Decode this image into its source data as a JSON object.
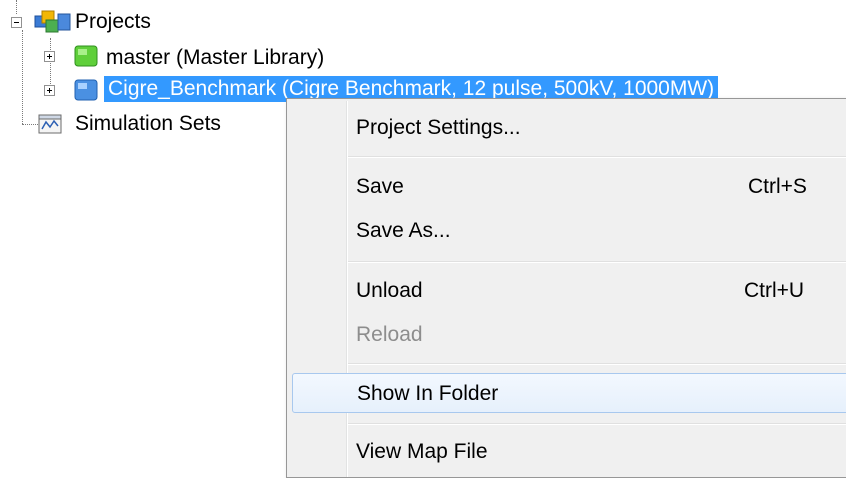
{
  "tree": {
    "root": {
      "label": "Projects",
      "icon": "projects-icon"
    },
    "children": [
      {
        "label": "master (Master Library)",
        "icon": "library-icon"
      },
      {
        "label": "Cigre_Benchmark (Cigre Benchmark, 12 pulse, 500kV, 1000MW)",
        "icon": "project-icon",
        "selected": true
      }
    ],
    "simulation_sets": {
      "label": "Simulation Sets",
      "icon": "simulation-sets-icon"
    }
  },
  "context_menu": {
    "project_settings": {
      "label": "Project Settings..."
    },
    "save": {
      "label": "Save",
      "shortcut": "Ctrl+S"
    },
    "save_as": {
      "label": "Save As..."
    },
    "unload": {
      "label": "Unload",
      "shortcut": "Ctrl+U"
    },
    "reload": {
      "label": "Reload",
      "disabled": true
    },
    "show_in_folder": {
      "label": "Show In Folder",
      "highlighted": true
    },
    "view_map_file": {
      "label": "View Map File"
    }
  },
  "colors": {
    "selection": "#3399ff",
    "menu_background": "#f0f0f0",
    "disabled_text": "#8d8d8d",
    "hover_border": "#a8c8ee"
  }
}
